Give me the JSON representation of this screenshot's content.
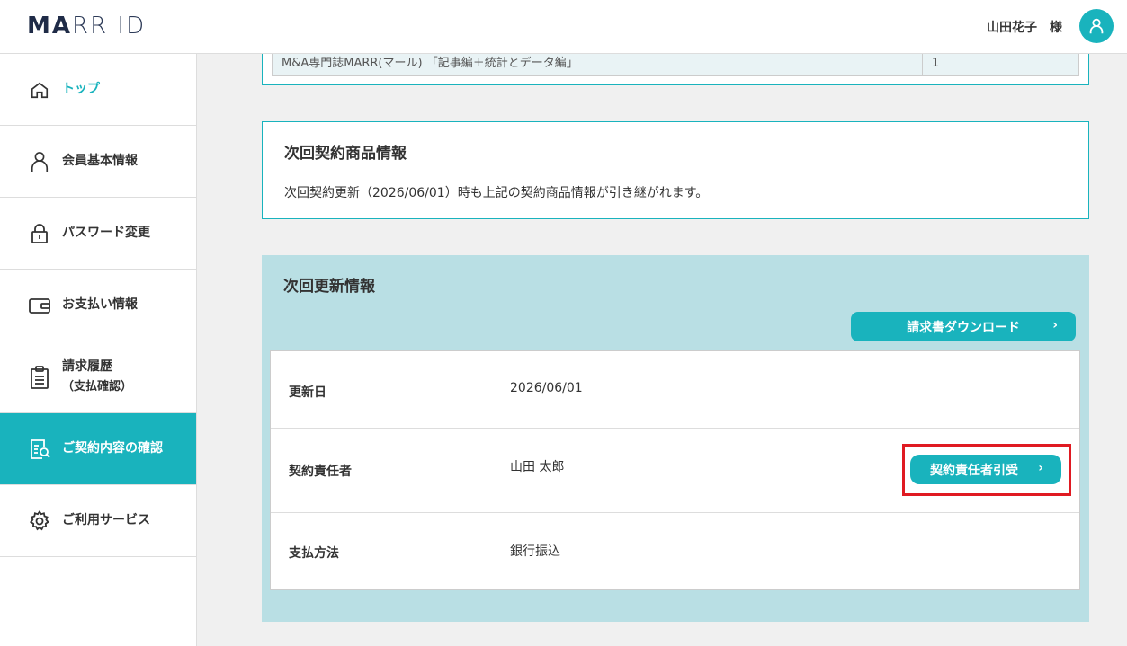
{
  "header": {
    "logo_bold": "MA",
    "logo_rest": "RR ID",
    "user_name": "山田花子　様"
  },
  "sidebar": {
    "items": [
      {
        "label": "トップ",
        "icon": "home-icon"
      },
      {
        "label": "会員基本情報",
        "icon": "person-icon"
      },
      {
        "label": "パスワード変更",
        "icon": "lock-icon"
      },
      {
        "label": "お支払い情報",
        "icon": "wallet-icon"
      },
      {
        "label": "請求履歴",
        "sublabel": "（支払確認）",
        "icon": "clipboard-icon"
      },
      {
        "label": "ご契約内容の確認",
        "icon": "contract-search-icon"
      },
      {
        "label": "ご利用サービス",
        "icon": "gear-icon"
      }
    ]
  },
  "prev_table": {
    "product": "M&A専門誌MARR(マール) 「記事編＋統計とデータ編」",
    "qty": "1"
  },
  "next_product": {
    "title": "次回契約商品情報",
    "text": "次回契約更新（2026/06/01）時も上記の契約商品情報が引き継がれます。"
  },
  "renewal": {
    "title": "次回更新情報",
    "download_label": "請求書ダウンロード",
    "rows": [
      {
        "key": "更新日",
        "value": "2026/06/01"
      },
      {
        "key": "契約責任者",
        "value": "山田 太郎"
      },
      {
        "key": "支払方法",
        "value": "銀行振込"
      }
    ],
    "transfer_label": "契約責任者引受"
  },
  "colors": {
    "accent": "#19b3bd",
    "panel_bg": "#b9dfe4",
    "highlight": "#e01a22"
  }
}
